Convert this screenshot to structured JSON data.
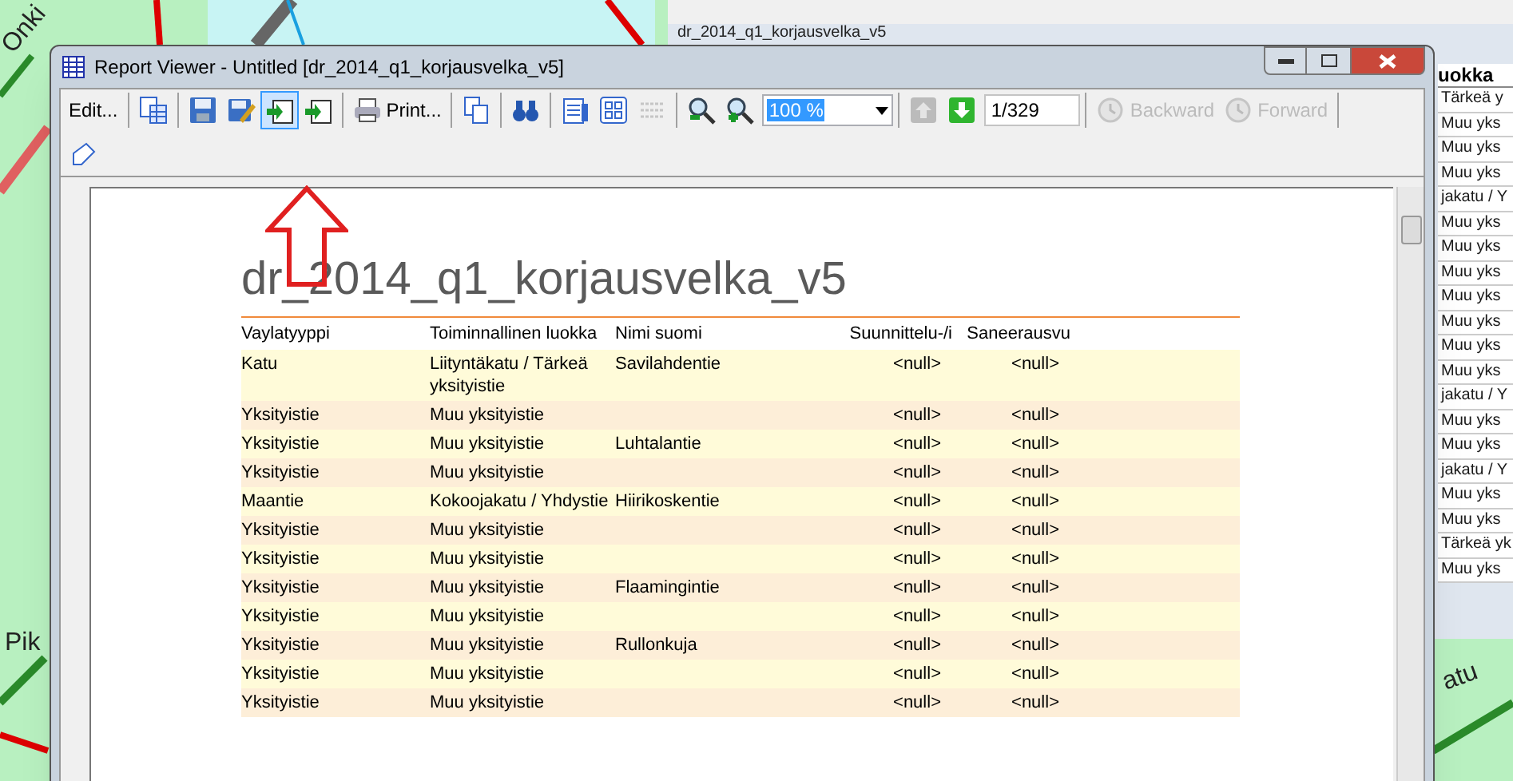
{
  "background_app": {
    "title": "dr_2014_q1_korjausvelka_v5",
    "table_header": "uokka",
    "table_cells": [
      "Tärkeä y",
      "Muu yks",
      "Muu yks",
      "Muu yks",
      "jakatu / Y",
      "Muu yks",
      "Muu yks",
      "Muu yks",
      "Muu yks",
      "Muu yks",
      "Muu yks",
      "Muu yks",
      "jakatu / Y",
      "Muu yks",
      "Muu yks",
      "jakatu / Y",
      "Muu yks",
      "Muu yks",
      "Tärkeä yk",
      "Muu yks"
    ]
  },
  "map": {
    "labels": [
      "Onki",
      "Pik",
      "atu"
    ]
  },
  "window": {
    "title": "Report Viewer - Untitled [dr_2014_q1_korjausvelka_v5]"
  },
  "toolbar": [
    {
      "kind": "text",
      "label": "Edit...",
      "selected": false,
      "disabled": false
    },
    {
      "kind": "sep"
    },
    {
      "kind": "icon",
      "selected": false,
      "disabled": false
    },
    {
      "kind": "sep"
    },
    {
      "kind": "icon",
      "selected": false,
      "disabled": false
    },
    {
      "kind": "icon",
      "selected": false,
      "disabled": false
    },
    {
      "kind": "icon",
      "selected": true,
      "disabled": false
    },
    {
      "kind": "icon",
      "selected": false,
      "disabled": false
    },
    {
      "kind": "sep"
    },
    {
      "kind": "text",
      "label": "Print...",
      "selected": false,
      "disabled": false
    },
    {
      "kind": "sep"
    },
    {
      "kind": "icon",
      "selected": false,
      "disabled": false
    },
    {
      "kind": "sep"
    },
    {
      "kind": "icon",
      "selected": false,
      "disabled": false
    },
    {
      "kind": "sep"
    },
    {
      "kind": "icon",
      "selected": false,
      "disabled": false
    },
    {
      "kind": "icon",
      "selected": false,
      "disabled": false
    },
    {
      "kind": "icon",
      "selected": false,
      "disabled": true
    },
    {
      "kind": "sep"
    },
    {
      "kind": "icon",
      "selected": false,
      "disabled": false
    },
    {
      "kind": "icon",
      "selected": false,
      "disabled": false
    },
    {
      "kind": "select",
      "value": "100 %"
    },
    {
      "kind": "sep"
    },
    {
      "kind": "icon",
      "selected": false,
      "disabled": true
    },
    {
      "kind": "icon",
      "selected": false,
      "disabled": false
    },
    {
      "kind": "field",
      "value": "1/329"
    },
    {
      "kind": "sep"
    },
    {
      "kind": "text",
      "label": "Backward",
      "selected": false,
      "disabled": true
    },
    {
      "kind": "text",
      "label": "Forward",
      "selected": false,
      "disabled": true
    },
    {
      "kind": "sep"
    },
    {
      "kind": "break"
    },
    {
      "kind": "icon",
      "selected": false,
      "disabled": false
    }
  ],
  "report": {
    "title": "dr_2014_q1_korjausvelka_v5",
    "columns": [
      "Vaylatyyppi",
      "Toiminnallinen luokka",
      "Nimi suomi",
      "Suunnittelu-/i",
      "Saneerausvu"
    ],
    "rows": [
      [
        "Katu",
        "Liityntäkatu / Tärkeä yksityistie",
        "Savilahdentie",
        "<null>",
        "<null>"
      ],
      [
        "Yksityistie",
        "Muu yksityistie",
        "",
        "<null>",
        "<null>"
      ],
      [
        "Yksityistie",
        "Muu yksityistie",
        "Luhtalantie",
        "<null>",
        "<null>"
      ],
      [
        "Yksityistie",
        "Muu yksityistie",
        "",
        "<null>",
        "<null>"
      ],
      [
        "Maantie",
        "Kokoojakatu / Yhdystie",
        "Hiirikoskentie",
        "<null>",
        "<null>"
      ],
      [
        "Yksityistie",
        "Muu yksityistie",
        "",
        "<null>",
        "<null>"
      ],
      [
        "Yksityistie",
        "Muu yksityistie",
        "",
        "<null>",
        "<null>"
      ],
      [
        "Yksityistie",
        "Muu yksityistie",
        "Flaamingintie",
        "<null>",
        "<null>"
      ],
      [
        "Yksityistie",
        "Muu yksityistie",
        "",
        "<null>",
        "<null>"
      ],
      [
        "Yksityistie",
        "Muu yksityistie",
        "Rullonkuja",
        "<null>",
        "<null>"
      ],
      [
        "Yksityistie",
        "Muu yksityistie",
        "",
        "<null>",
        "<null>"
      ],
      [
        "Yksityistie",
        "Muu yksityistie",
        "",
        "<null>",
        "<null>"
      ]
    ]
  }
}
